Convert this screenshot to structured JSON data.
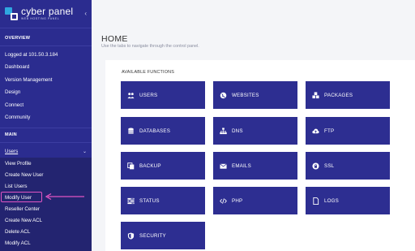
{
  "brand": {
    "name": "cyber panel",
    "tagline": "WEB HOSTING PANEL"
  },
  "sidebar": {
    "overview_title": "OVERVIEW",
    "logged_in": "Logged at 101.50.3.184",
    "items": [
      "Dashboard",
      "Version Management",
      "Design",
      "Connect",
      "Community"
    ],
    "main_title": "MAIN",
    "users_label": "Users",
    "users_submenu": [
      "View Profile",
      "Create New User",
      "List Users",
      "Modify User",
      "Reseller Center",
      "Create New ACL",
      "Delete ACL",
      "Modify ACL"
    ]
  },
  "main": {
    "title": "HOME",
    "subtitle": "Use the tabs to navigate through the control panel.",
    "panel_title": "AVAILABLE FUNCTIONS",
    "tiles": [
      {
        "label": "USERS",
        "icon": "users-icon"
      },
      {
        "label": "WEBSITES",
        "icon": "globe-icon"
      },
      {
        "label": "PACKAGES",
        "icon": "cubes-icon"
      },
      {
        "label": "DATABASES",
        "icon": "database-icon"
      },
      {
        "label": "DNS",
        "icon": "sitemap-icon"
      },
      {
        "label": "FTP",
        "icon": "cloud-upload-icon"
      },
      {
        "label": "BACKUP",
        "icon": "copy-icon"
      },
      {
        "label": "EMAILS",
        "icon": "envelope-icon"
      },
      {
        "label": "SSL",
        "icon": "lock-icon"
      },
      {
        "label": "STATUS",
        "icon": "tasks-icon"
      },
      {
        "label": "PHP",
        "icon": "code-icon"
      },
      {
        "label": "LOGS",
        "icon": "file-icon"
      },
      {
        "label": "SECURITY",
        "icon": "shield-icon"
      }
    ]
  },
  "colors": {
    "sidebar_bg": "#2b2c8f",
    "submenu_bg": "#232470",
    "tile_bg": "#2d2e91",
    "highlight": "#e055c2"
  }
}
